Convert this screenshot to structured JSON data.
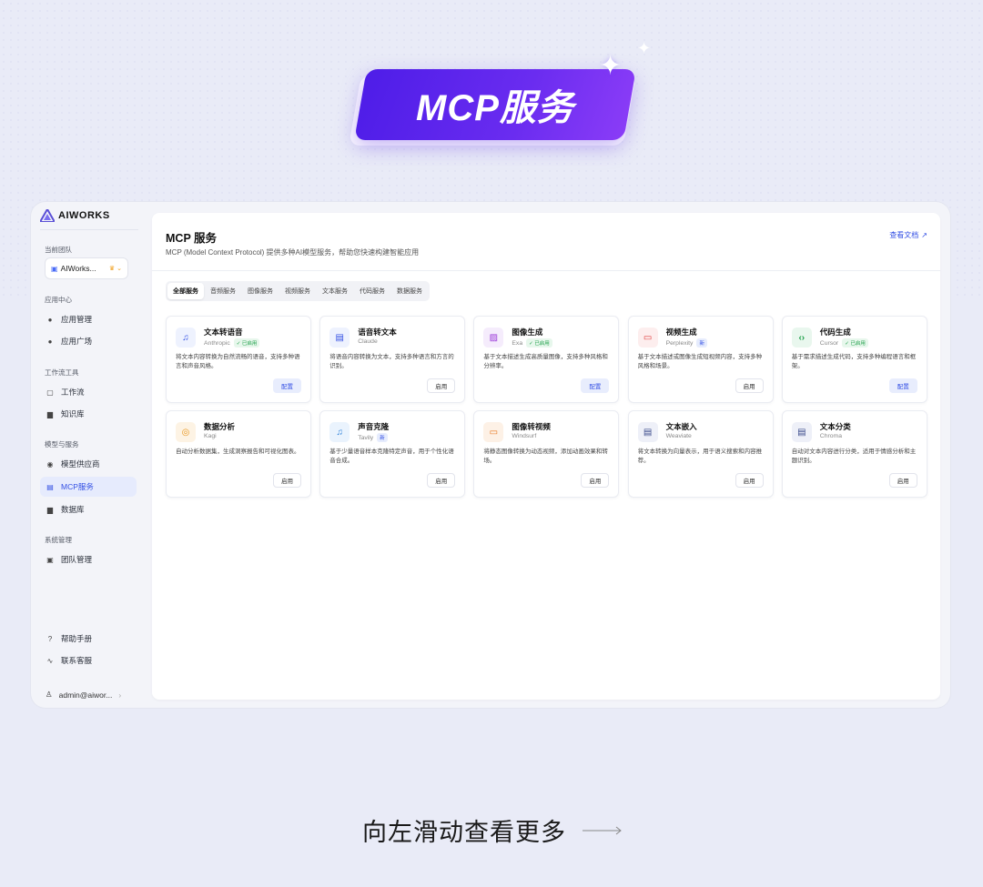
{
  "hero": {
    "title": "MCP服务"
  },
  "app": {
    "logo": "AIWORKS",
    "sidebar": {
      "team_label": "当前团队",
      "team_name": "AIWorks...",
      "sections": [
        {
          "label": "应用中心",
          "items": [
            {
              "label": "应用管理",
              "icon": "user-icon"
            },
            {
              "label": "应用广场",
              "icon": "user-icon"
            }
          ]
        },
        {
          "label": "工作流工具",
          "items": [
            {
              "label": "工作流",
              "icon": "square-icon"
            },
            {
              "label": "知识库",
              "icon": "book-icon"
            }
          ]
        },
        {
          "label": "模型与服务",
          "items": [
            {
              "label": "模型供应商",
              "icon": "robot-icon"
            },
            {
              "label": "MCP服务",
              "icon": "server-icon"
            },
            {
              "label": "数据库",
              "icon": "database-icon"
            }
          ]
        },
        {
          "label": "系统管理",
          "items": [
            {
              "label": "团队管理",
              "icon": "team-icon"
            }
          ]
        }
      ],
      "help": "帮助手册",
      "support": "联系客服",
      "user": "admin@aiwor..."
    },
    "main": {
      "title": "MCP 服务",
      "subtitle": "MCP (Model Context Protocol) 提供多种AI模型服务，帮助您快速构建智能应用",
      "doc_link": "查看文档",
      "tabs": [
        "全部服务",
        "音频服务",
        "图像服务",
        "视频服务",
        "文本服务",
        "代码服务",
        "数据服务"
      ],
      "cards": [
        {
          "title": "文本转语音",
          "provider": "Anthropic",
          "badge": "✓ 已启用",
          "badge_type": "green",
          "desc": "将文本内容转换为自然流畅的语音，支持多种语言和声音风格。",
          "button": "配置",
          "button_type": "config",
          "icon": "music-note-icon",
          "glyph": "♫",
          "color": "#3450e4",
          "bg": "#eef2fe"
        },
        {
          "title": "语音转文本",
          "provider": "Claude",
          "badge": "",
          "badge_type": "",
          "desc": "将语音内容转换为文本，支持多种语言和方言的识别。",
          "button": "启用",
          "button_type": "enable",
          "icon": "document-icon",
          "glyph": "▤",
          "color": "#3450e4",
          "bg": "#eef2fe"
        },
        {
          "title": "图像生成",
          "provider": "Exa",
          "badge": "✓ 已启用",
          "badge_type": "green",
          "desc": "基于文本描述生成高质量图像，支持多种风格和分辨率。",
          "button": "配置",
          "button_type": "config",
          "icon": "image-icon",
          "glyph": "▨",
          "color": "#9b3ad8",
          "bg": "#f5ecfc"
        },
        {
          "title": "视频生成",
          "provider": "Perplexity",
          "badge": "新",
          "badge_type": "blue",
          "desc": "基于文本描述或图像生成短视频内容，支持多种风格和场景。",
          "button": "启用",
          "button_type": "enable",
          "icon": "video-icon",
          "glyph": "▭",
          "color": "#e03a3a",
          "bg": "#fdeeee"
        },
        {
          "title": "代码生成",
          "provider": "Cursor",
          "badge": "✓ 已启用",
          "badge_type": "green",
          "desc": "基于需求描述生成代码，支持多种编程语言和框架。",
          "button": "配置",
          "button_type": "config",
          "icon": "code-icon",
          "glyph": "‹›",
          "color": "#20a04a",
          "bg": "#e9f7ee"
        },
        {
          "title": "数据分析",
          "provider": "Kagi",
          "badge": "",
          "badge_type": "",
          "desc": "自动分析数据集，生成洞察报告和可视化图表。",
          "button": "启用",
          "button_type": "enable",
          "icon": "database-icon",
          "glyph": "◎",
          "color": "#e8961e",
          "bg": "#fdf3e4"
        },
        {
          "title": "声音克隆",
          "provider": "Tavily",
          "badge": "新",
          "badge_type": "blue",
          "desc": "基于少量语音样本克隆特定声音，用于个性化语音合成。",
          "button": "启用",
          "button_type": "enable",
          "icon": "music-note-icon",
          "glyph": "♫",
          "color": "#2a7fd8",
          "bg": "#eaf3fd"
        },
        {
          "title": "图像转视频",
          "provider": "Windsurf",
          "badge": "",
          "badge_type": "",
          "desc": "将静态图像转换为动态视频，添加动画效果和转场。",
          "button": "启用",
          "button_type": "enable",
          "icon": "video-icon",
          "glyph": "▭",
          "color": "#e8761e",
          "bg": "#fdf1e6"
        },
        {
          "title": "文本嵌入",
          "provider": "Weaviate",
          "badge": "",
          "badge_type": "",
          "desc": "将文本转换为向量表示，用于语义搜索和内容推荐。",
          "button": "启用",
          "button_type": "enable",
          "icon": "document-icon",
          "glyph": "▤",
          "color": "#3a4a8a",
          "bg": "#eef0f8"
        },
        {
          "title": "文本分类",
          "provider": "Chroma",
          "badge": "",
          "badge_type": "",
          "desc": "自动对文本内容进行分类，适用于情感分析和主题识别。",
          "button": "启用",
          "button_type": "enable",
          "icon": "document-icon",
          "glyph": "▤",
          "color": "#3a4a8a",
          "bg": "#eef0f8"
        }
      ]
    }
  },
  "footer": {
    "text": "向左滑动查看更多"
  }
}
